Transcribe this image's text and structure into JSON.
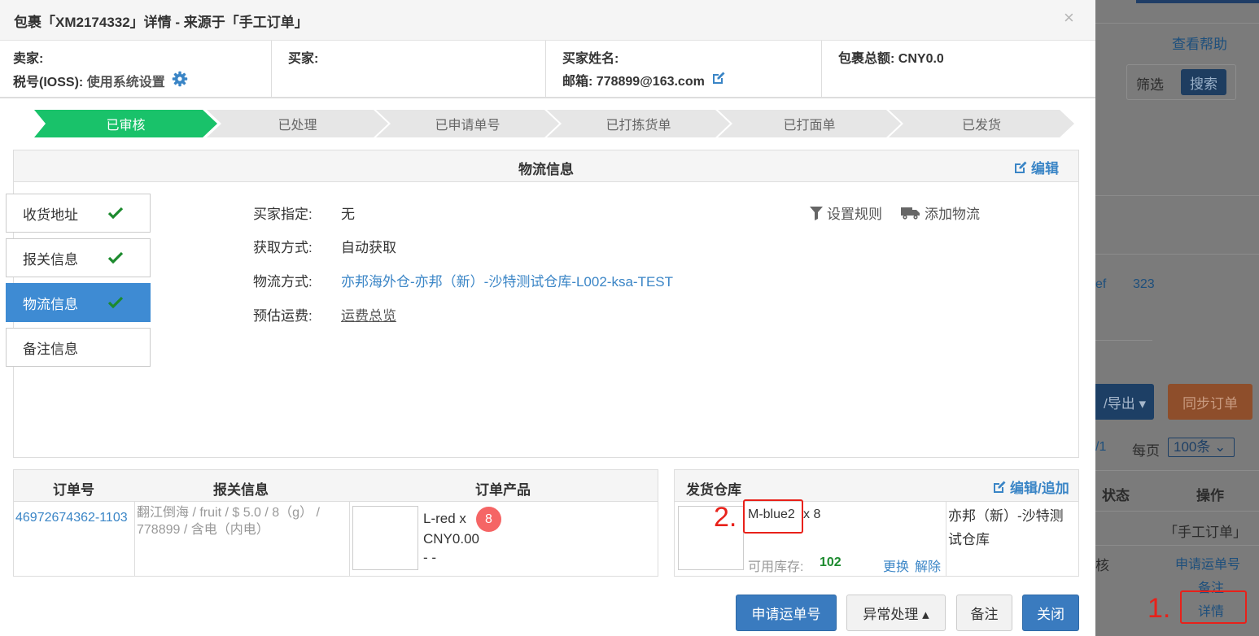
{
  "modal": {
    "title": "包裹「XM2174332」详情 - 来源于「手工订单」",
    "close": "×"
  },
  "info": {
    "seller_label": "卖家:",
    "tax_label": "税号(IOSS):",
    "tax_value": "使用系统设置",
    "buyer_label": "买家:",
    "buyer_name_label": "买家姓名:",
    "email_label": "邮箱:",
    "email_value": "778899@163.com",
    "total_label": "包裹总额:",
    "total_value": "CNY0.0"
  },
  "steps": [
    "已审核",
    "已处理",
    "已申请单号",
    "已打拣货单",
    "已打面单",
    "已发货"
  ],
  "logistics": {
    "title": "物流信息",
    "edit": "编辑",
    "fields": [
      {
        "label": "买家指定:",
        "value": "无"
      },
      {
        "label": "获取方式:",
        "value": "自动获取"
      },
      {
        "label": "物流方式:",
        "value": "亦邦海外仓-亦邦（新）-沙特测试仓库-L002-ksa-TEST"
      },
      {
        "label": "预估运费:",
        "value": "运费总览"
      }
    ],
    "set_rule": "设置规则",
    "add_logistics": "添加物流"
  },
  "side_tabs": [
    {
      "label": "收货地址",
      "checked": true,
      "active": false
    },
    {
      "label": "报关信息",
      "checked": true,
      "active": false
    },
    {
      "label": "物流信息",
      "checked": true,
      "active": true
    },
    {
      "label": "备注信息",
      "checked": false,
      "active": false
    }
  ],
  "orders": {
    "headers": [
      "订单号",
      "报关信息",
      "订单产品"
    ],
    "order_no": "46972674362-1103",
    "customs": "翻江倒海 / fruit / $ 5.0 / 8（g） / 778899 / 含电（内电）",
    "product_name": "L-red x",
    "product_qty": "8",
    "product_price": "CNY0.00",
    "product_dash": "- -"
  },
  "warehouse": {
    "title": "发货仓库",
    "edit": "编辑/追加",
    "sku": "M-blue2",
    "qty": "x 8",
    "stock_label": "可用库存:",
    "stock_value": "102",
    "change": "更换",
    "remove": "解除",
    "name": "亦邦（新）-沙特测试仓库",
    "annotation": "2."
  },
  "footer": {
    "apply": "申请运单号",
    "exception": "异常处理 ▴",
    "note": "备注",
    "close": "关闭"
  },
  "background": {
    "help": "查看帮助",
    "filter": "筛选",
    "search": "搜索",
    "ef": "ef",
    "num": "323",
    "export": "/导出 ▾",
    "sync": "同步订单",
    "page": "/1",
    "per_page": "每页",
    "per_value": "100条 ⌄",
    "th_status": "状态",
    "th_op": "操作",
    "source": "「手工订单」",
    "status_text": "核",
    "op_apply": "申请运单号",
    "op_note": "备注",
    "op_detail": "详情",
    "annotation": "1."
  },
  "colors": {
    "primary": "#3a7bbf",
    "active_step": "#19c26a",
    "link": "#3a85c6",
    "annotation_red": "#e8211a",
    "badge": "#f56565"
  }
}
